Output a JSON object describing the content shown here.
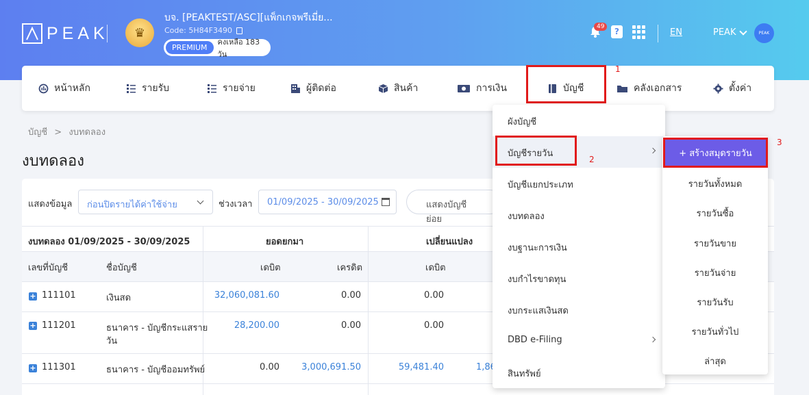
{
  "header": {
    "logo": "PEAK",
    "company_name": "บจ. [PEAKTEST/ASC][แพ็กเกจพรีเมี่ย...",
    "company_code": "Code: 5H84F3490",
    "plan": "PREMIUM",
    "plan_remaining": "คงเหลือ 183 วัน",
    "notifications": "49",
    "lang": "EN",
    "user": "PEAK",
    "user_avatar": "PEAK"
  },
  "nav": {
    "items": [
      {
        "label": "หน้าหลัก",
        "icon": "dashboard-icon"
      },
      {
        "label": "รายรับ",
        "icon": "income-icon"
      },
      {
        "label": "รายจ่าย",
        "icon": "expense-icon"
      },
      {
        "label": "ผู้ติดต่อ",
        "icon": "contacts-icon"
      },
      {
        "label": "สินค้า",
        "icon": "box-icon"
      },
      {
        "label": "การเงิน",
        "icon": "money-icon"
      },
      {
        "label": "บัญชี",
        "icon": "book-icon"
      },
      {
        "label": "คลังเอกสาร",
        "icon": "folder-icon"
      },
      {
        "label": "ตั้งค่า",
        "icon": "gear-icon"
      }
    ]
  },
  "annotations": {
    "one": "1",
    "two": "2",
    "three": "3"
  },
  "breadcrumb": {
    "parent": "บัญชี",
    "sep": ">",
    "current": "งบทดลอง"
  },
  "page_title": "งบทดลอง",
  "filters": {
    "show_label": "แสดงข้อมูล",
    "show_value": "ก่อนปิดรายได้ค่าใช้จ่าย",
    "period_label": "ช่วงเวลา",
    "period_value": "01/09/2025 - 30/09/2025",
    "show_accounts_button": "แสดงบัญชีย่อย"
  },
  "table": {
    "title": "งบทดลอง 01/09/2025 - 30/09/2025",
    "group_opening": "ยอดยกมา",
    "group_change": "เปลี่ยนแปลง",
    "col_code": "เลขที่บัญชี",
    "col_name": "ชื่อบัญชี",
    "col_debit": "เดบิต",
    "col_credit": "เครดิต",
    "col_debit2": "เดบิต",
    "rows": [
      {
        "code": "111101",
        "name": "เงินสด",
        "name2": "",
        "open_debit": "32,060,081.60",
        "open_credit": "0.00",
        "chg_debit": "0.00",
        "chg_credit": ""
      },
      {
        "code": "111201",
        "name": "ธนาคาร - บัญชีกระแสราย",
        "name2": "วัน",
        "open_debit": "28,200.00",
        "open_credit": "0.00",
        "chg_debit": "0.00",
        "chg_credit": ""
      },
      {
        "code": "111301",
        "name": "ธนาคาร - บัญชีออมทรัพย์",
        "name2": "",
        "open_debit": "0.00",
        "open_credit": "3,000,691.50",
        "chg_debit": "59,481.40",
        "chg_credit": "1,86"
      }
    ]
  },
  "menu": {
    "items": [
      {
        "label": "ผังบัญชี",
        "has_sub": false
      },
      {
        "label": "บัญชีรายวัน",
        "has_sub": true
      },
      {
        "label": "บัญชีแยกประเภท",
        "has_sub": false
      },
      {
        "label": "งบทดลอง",
        "has_sub": false
      },
      {
        "label": "งบฐานะการเงิน",
        "has_sub": false
      },
      {
        "label": "งบกำไรขาดทุน",
        "has_sub": false
      },
      {
        "label": "งบกระแสเงินสด",
        "has_sub": false
      },
      {
        "label": "DBD e-Filing",
        "has_sub": true
      },
      {
        "label": "สินทรัพย์",
        "has_sub": false
      }
    ]
  },
  "submenu": {
    "create": "+ สร้างสมุดรายวัน",
    "items": [
      "รายวันทั้งหมด",
      "รายวันซื้อ",
      "รายวันขาย",
      "รายวันจ่าย",
      "รายวันรับ",
      "รายวันทั่วไป",
      "ล่าสุด"
    ]
  }
}
